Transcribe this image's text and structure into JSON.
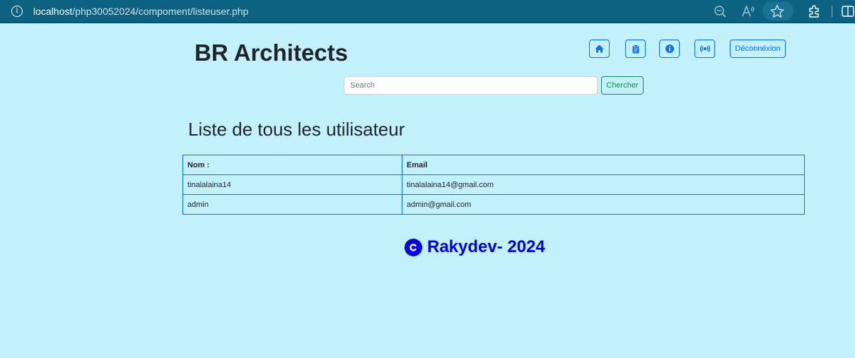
{
  "browser": {
    "url_host": "localhost",
    "url_path": "/php30052024/compoment/listeuser.php"
  },
  "header": {
    "brand": "BR Architects",
    "nav_icons": [
      "home-icon",
      "clipboard-icon",
      "info-icon",
      "contact-icon"
    ],
    "logout_label": "Déconnéxion"
  },
  "search": {
    "placeholder": "Search",
    "value": "",
    "button_label": "Chercher"
  },
  "main": {
    "title": "Liste de tous les utilisateur",
    "table": {
      "headers": [
        "Nom :",
        "Email"
      ],
      "rows": [
        [
          "tinalalaina14",
          "tinalalaina14@gmail.com"
        ],
        [
          "admin",
          "admin@gmail.com"
        ]
      ]
    }
  },
  "footer": {
    "text": "Rakydev- 2024"
  },
  "colors": {
    "page_bg": "#c3f1fb",
    "browser_bar": "#0d6282",
    "primary": "#0d6efd",
    "success": "#198754",
    "footer_text": "#0000ee"
  }
}
